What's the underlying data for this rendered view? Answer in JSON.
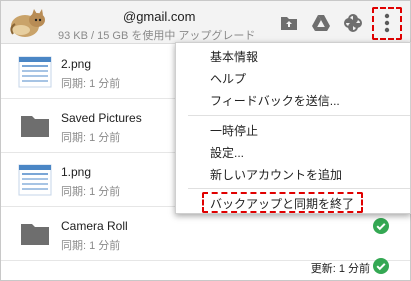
{
  "header": {
    "email": "@gmail.com",
    "storage": "93 KB / 15 GB を使用中 アップグレード",
    "icons": [
      "cat-avatar",
      "folder-upload-icon",
      "google-drive-icon",
      "google-photos-icon",
      "more-vert-icon"
    ]
  },
  "files": [
    {
      "name": "2.png",
      "status": "同期: 1 分前",
      "type": "image"
    },
    {
      "name": "Saved Pictures",
      "status": "同期: 1 分前",
      "type": "folder"
    },
    {
      "name": "1.png",
      "status": "同期: 1 分前",
      "type": "image"
    },
    {
      "name": "Camera Roll",
      "status": "同期: 1 分前",
      "type": "folder"
    }
  ],
  "footer": {
    "updated": "更新: 1 分前"
  },
  "menu": {
    "items": [
      "基本情報",
      "ヘルプ",
      "フィードバックを送信...",
      "一時停止",
      "設定...",
      "新しいアカウントを追加",
      "バックアップと同期を終了"
    ]
  },
  "colors": {
    "check_green": "#34a853",
    "folder_grey": "#6e6e6e",
    "highlight_red": "#e00000"
  }
}
